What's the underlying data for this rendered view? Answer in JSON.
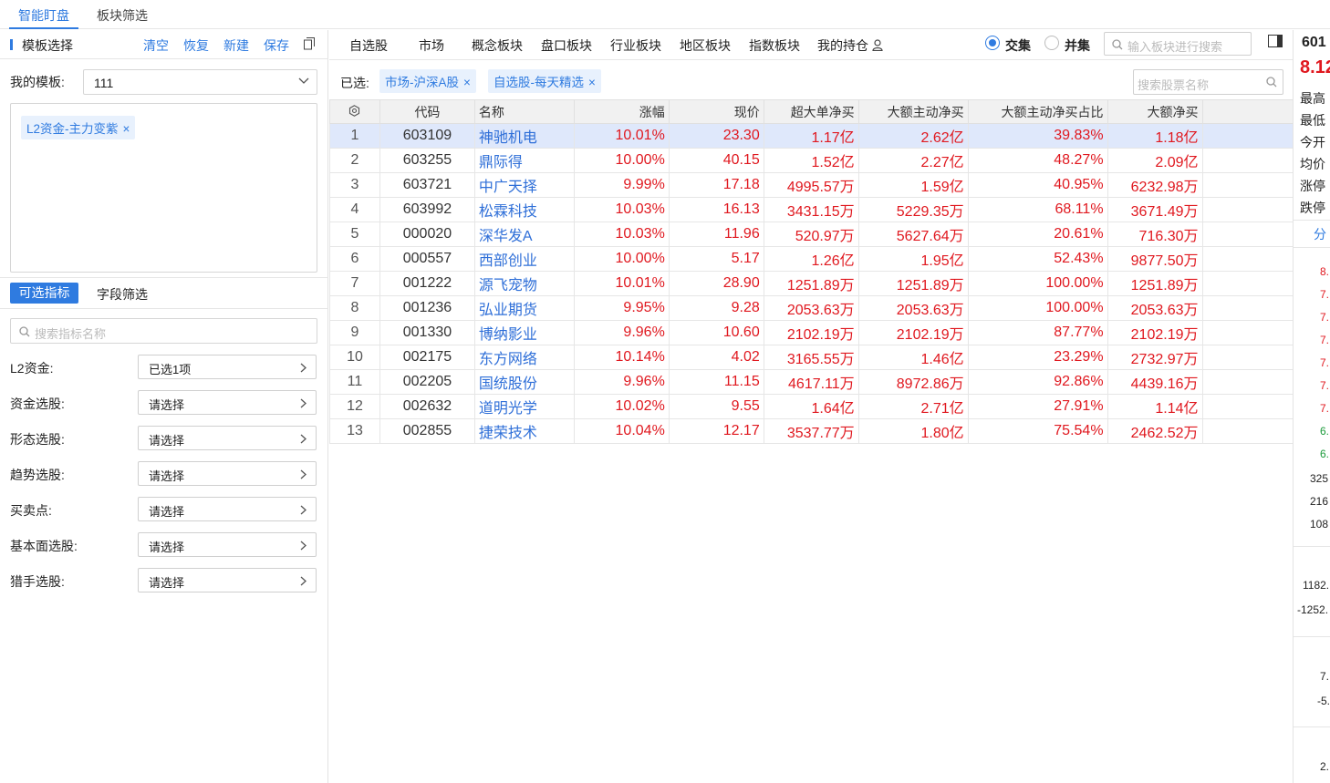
{
  "top_tabs": [
    "智能盯盘",
    "板块筛选"
  ],
  "left": {
    "section_title": "模板选择",
    "actions": [
      "清空",
      "恢复",
      "新建",
      "保存"
    ],
    "my_template_label": "我的模板:",
    "my_template_value": "111",
    "template_tag": "L2资金-主力变紫",
    "tag_close": "×",
    "subtabs": [
      "可选指标",
      "字段筛选"
    ],
    "indicator_search_placeholder": "搜索指标名称",
    "filters": [
      {
        "label": "L2资金:",
        "value": "已选1项"
      },
      {
        "label": "资金选股:",
        "value": "请选择"
      },
      {
        "label": "形态选股:",
        "value": "请选择"
      },
      {
        "label": "趋势选股:",
        "value": "请选择"
      },
      {
        "label": "买卖点:",
        "value": "请选择"
      },
      {
        "label": "基本面选股:",
        "value": "请选择"
      },
      {
        "label": "猎手选股:",
        "value": "请选择"
      }
    ]
  },
  "main": {
    "nav": [
      "自选股",
      "市场",
      "概念板块",
      "盘口板块",
      "行业板块",
      "地区板块",
      "指数板块",
      "我的持仓"
    ],
    "radio": {
      "intersection": "交集",
      "union": "并集",
      "selected": "交集"
    },
    "block_search_placeholder": "输入板块进行搜索",
    "selected_label": "已选:",
    "selected_chips": [
      "市场-沪深A股",
      "自选股-每天精选"
    ],
    "stock_search_placeholder": "搜索股票名称",
    "columns": [
      "代码",
      "名称",
      "涨幅",
      "现价",
      "超大单净买",
      "大额主动净买",
      "大额主动净买占比",
      "大额净买"
    ],
    "rows": [
      [
        "1",
        "603109",
        "神驰机电",
        "10.01%",
        "23.30",
        "1.17亿",
        "2.62亿",
        "39.83%",
        "1.18亿"
      ],
      [
        "2",
        "603255",
        "鼎际得",
        "10.00%",
        "40.15",
        "1.52亿",
        "2.27亿",
        "48.27%",
        "2.09亿"
      ],
      [
        "3",
        "603721",
        "中广天择",
        "9.99%",
        "17.18",
        "4995.57万",
        "1.59亿",
        "40.95%",
        "6232.98万"
      ],
      [
        "4",
        "603992",
        "松霖科技",
        "10.03%",
        "16.13",
        "3431.15万",
        "5229.35万",
        "68.11%",
        "3671.49万"
      ],
      [
        "5",
        "000020",
        "深华发A",
        "10.03%",
        "11.96",
        "520.97万",
        "5627.64万",
        "20.61%",
        "716.30万"
      ],
      [
        "6",
        "000557",
        "西部创业",
        "10.00%",
        "5.17",
        "1.26亿",
        "1.95亿",
        "52.43%",
        "9877.50万"
      ],
      [
        "7",
        "001222",
        "源飞宠物",
        "10.01%",
        "28.90",
        "1251.89万",
        "1251.89万",
        "100.00%",
        "1251.89万"
      ],
      [
        "8",
        "001236",
        "弘业期货",
        "9.95%",
        "9.28",
        "2053.63万",
        "2053.63万",
        "100.00%",
        "2053.63万"
      ],
      [
        "9",
        "001330",
        "博纳影业",
        "9.96%",
        "10.60",
        "2102.19万",
        "2102.19万",
        "87.77%",
        "2102.19万"
      ],
      [
        "10",
        "002175",
        "东方网络",
        "10.14%",
        "4.02",
        "3165.55万",
        "1.46亿",
        "23.29%",
        "2732.97万"
      ],
      [
        "11",
        "002205",
        "国统股份",
        "9.96%",
        "11.15",
        "4617.11万",
        "8972.86万",
        "92.86%",
        "4439.16万"
      ],
      [
        "12",
        "002632",
        "道明光学",
        "10.02%",
        "9.55",
        "1.64亿",
        "2.71亿",
        "27.91%",
        "1.14亿"
      ],
      [
        "13",
        "002855",
        "捷荣技术",
        "10.04%",
        "12.17",
        "3537.77万",
        "1.80亿",
        "75.54%",
        "2462.52万"
      ]
    ]
  },
  "right": {
    "code": "601",
    "price": "8.12",
    "labels": [
      "最高",
      "最低",
      "今开",
      "均价",
      "涨停",
      "跌停"
    ],
    "tab": "分",
    "prices": [
      "8.",
      "7.",
      "7.",
      "7.",
      "7.",
      "7.",
      "7.",
      "6.",
      "6."
    ],
    "volumes": [
      "325",
      "216",
      "108"
    ],
    "flows": [
      "1182.",
      "-1252."
    ],
    "lower": [
      "7.",
      "-5.",
      "2."
    ]
  },
  "colors": {
    "accent": "#2f7be0",
    "up": "#e0181f",
    "link": "#2f6fd8",
    "highlight": "#dfe8fb"
  }
}
